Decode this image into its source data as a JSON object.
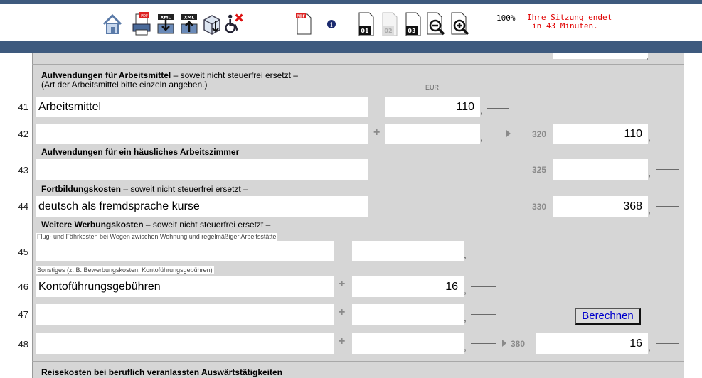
{
  "toolbar": {
    "zoom": "100%",
    "session_line1": "Ihre Sitzung endet",
    "session_line2": "in 43 Minuten.",
    "icons": [
      "home-icon",
      "print-pdf-icon",
      "xml-export-icon",
      "xml-import-icon",
      "package-icon",
      "accessibility-icon",
      "pdf-icon",
      "info-icon",
      "page-01-icon",
      "page-02-icon",
      "page-03-icon",
      "zoom-out-icon",
      "zoom-in-icon"
    ],
    "page_labels": [
      "01",
      "02",
      "03"
    ],
    "pdf_badge": "PDF",
    "xml_badge": "XML",
    "info_glyph": "i"
  },
  "form": {
    "eur_label": "EUR",
    "arbeitsmittel_heading": "Aufwendungen für Arbeitsmittel",
    "arbeitsmittel_suffix": " – soweit nicht steuerfrei ersetzt –",
    "arbeitsmittel_sub": "(Art der Arbeitsmittel bitte einzeln angeben.)",
    "arbeitszimmer_heading": "Aufwendungen für ein häusliches Arbeitszimmer",
    "fortbildung_heading": "Fortbildungskosten",
    "fortbildung_suffix": " – soweit nicht steuerfrei ersetzt –",
    "weitere_heading": "Weitere Werbungskosten",
    "weitere_suffix": " – soweit nicht steuerfrei ersetzt –",
    "flug_hint": "Flug- und Fährkosten bei Wegen zwischen Wohnung und regelmäßiger Arbeitsstätte",
    "sonstiges_hint": "Sonstiges (z. B. Bewerbungskosten, Kontoführungsgebühren)",
    "reisekosten_heading": "Reisekosten bei beruflich veranlassten Auswärtstätigkeiten",
    "rows": {
      "r41": {
        "num": "41",
        "text": "Arbeitsmittel",
        "amount": "110"
      },
      "r42": {
        "num": "42",
        "text": "",
        "amount": "",
        "code": "320",
        "total": "110"
      },
      "r43": {
        "num": "43",
        "text": "",
        "code": "325",
        "total": ""
      },
      "r44": {
        "num": "44",
        "text": "deutsch als fremdsprache kurse",
        "code": "330",
        "total": "368"
      },
      "r45": {
        "num": "45",
        "text": "",
        "amount": ""
      },
      "r46": {
        "num": "46",
        "text": "Kontoführungsgebühren",
        "amount": "16"
      },
      "r47": {
        "num": "47",
        "text": "",
        "amount": ""
      },
      "r48": {
        "num": "48",
        "text": "",
        "amount": "",
        "code": "380",
        "total": "16"
      }
    },
    "calc_button": "Berechnen",
    "plus": "+",
    "comma": ","
  }
}
